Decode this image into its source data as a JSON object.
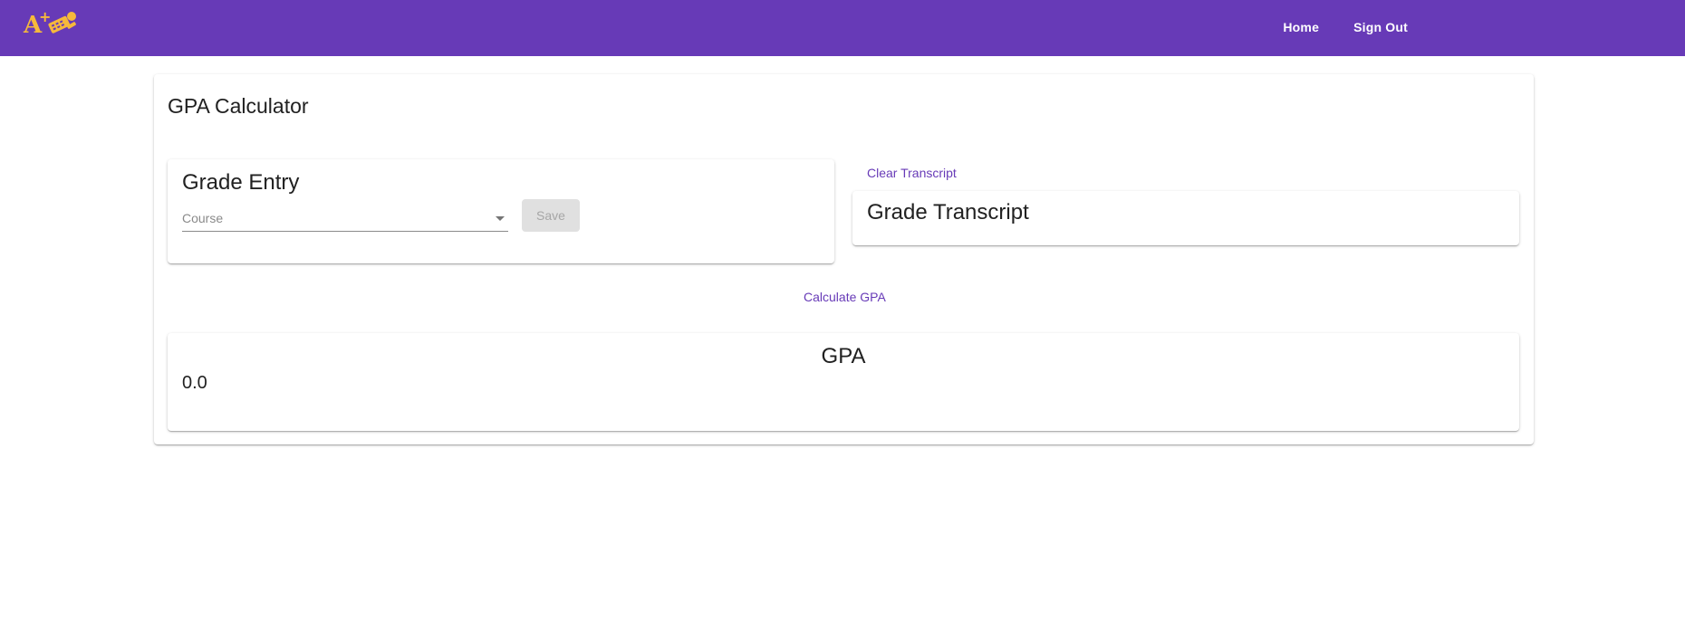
{
  "header": {
    "logo_icon": "a-plus-calculator-logo-icon",
    "nav": [
      {
        "label": "Home"
      },
      {
        "label": "Sign Out"
      }
    ],
    "colors": {
      "bar": "#673ab7",
      "logo": "#f6b93b"
    }
  },
  "page": {
    "title": "GPA Calculator"
  },
  "grade_entry": {
    "title": "Grade Entry",
    "course_placeholder": "Course",
    "save_label": "Save"
  },
  "transcript": {
    "clear_label": "Clear Transcript",
    "title": "Grade Transcript"
  },
  "calculate": {
    "label": "Calculate GPA"
  },
  "gpa": {
    "title": "GPA",
    "value": "0.0"
  },
  "colors": {
    "accent": "#673ab7",
    "disabled_button_bg": "#e0e0e0"
  }
}
